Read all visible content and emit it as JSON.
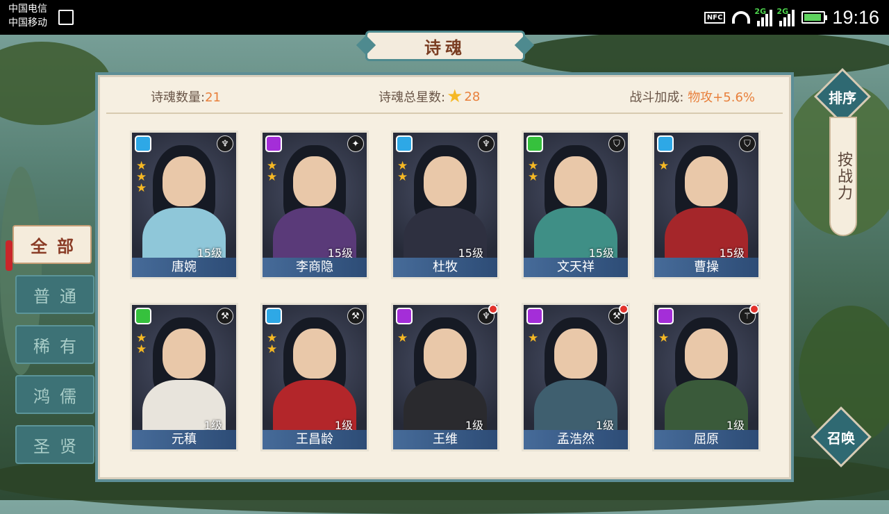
{
  "status_bar": {
    "carrier_1": "中国电信",
    "carrier_2": "中国移动",
    "nfc": "NFC",
    "net_1": "2G",
    "net_2": "2G",
    "time": "19:16"
  },
  "title": "诗魂",
  "stats": {
    "count_label": "诗魂数量:",
    "count_value": "21",
    "stars_label": "诗魂总星数:",
    "stars_value": "28",
    "bonus_label": "战斗加成:",
    "bonus_value": "物攻+5.6%"
  },
  "tabs": [
    {
      "label": "全部",
      "active": true
    },
    {
      "label": "普通",
      "active": false
    },
    {
      "label": "稀有",
      "active": false
    },
    {
      "label": "鸿儒",
      "active": false
    },
    {
      "label": "圣贤",
      "active": false
    }
  ],
  "sort_button": "排序",
  "sort_mode": "按战力",
  "summon_button": "召唤",
  "cards": [
    {
      "name": "唐婉",
      "level": "15级",
      "stars": 3,
      "gem": "blue",
      "role_icon": "bow-icon",
      "outfit": "#8fc7d9",
      "alert": false
    },
    {
      "name": "李商隐",
      "level": "15级",
      "stars": 2,
      "gem": "purple",
      "role_icon": "dagger-icon",
      "outfit": "#5a3a79",
      "alert": false
    },
    {
      "name": "杜牧",
      "level": "15级",
      "stars": 2,
      "gem": "blue",
      "role_icon": "bow-icon",
      "outfit": "#2e3040",
      "alert": false
    },
    {
      "name": "文天祥",
      "level": "15级",
      "stars": 2,
      "gem": "green",
      "role_icon": "shield-icon",
      "outfit": "#3f8f86",
      "alert": false
    },
    {
      "name": "曹操",
      "level": "15级",
      "stars": 1,
      "gem": "blue",
      "role_icon": "shield-icon",
      "outfit": "#a5262a",
      "alert": false
    },
    {
      "name": "元稹",
      "level": "1级",
      "stars": 2,
      "gem": "green",
      "role_icon": "axe-icon",
      "outfit": "#e8e4dc",
      "alert": false
    },
    {
      "name": "王昌龄",
      "level": "1级",
      "stars": 2,
      "gem": "blue",
      "role_icon": "axe-icon",
      "outfit": "#b3262a",
      "alert": false
    },
    {
      "name": "王维",
      "level": "1级",
      "stars": 1,
      "gem": "purple",
      "role_icon": "bow-icon",
      "outfit": "#2a2a2e",
      "alert": true
    },
    {
      "name": "孟浩然",
      "level": "1级",
      "stars": 1,
      "gem": "purple",
      "role_icon": "axe-icon",
      "outfit": "#3f5f6f",
      "alert": true
    },
    {
      "name": "屈原",
      "level": "1级",
      "stars": 1,
      "gem": "purple",
      "role_icon": "staff-icon",
      "outfit": "#3a5a3a",
      "alert": true
    }
  ],
  "colors": {
    "accent_teal": "#4e8a8f",
    "title_text": "#7a3d22",
    "highlight_orange": "#e8803c",
    "alert_red": "#e2322b"
  }
}
